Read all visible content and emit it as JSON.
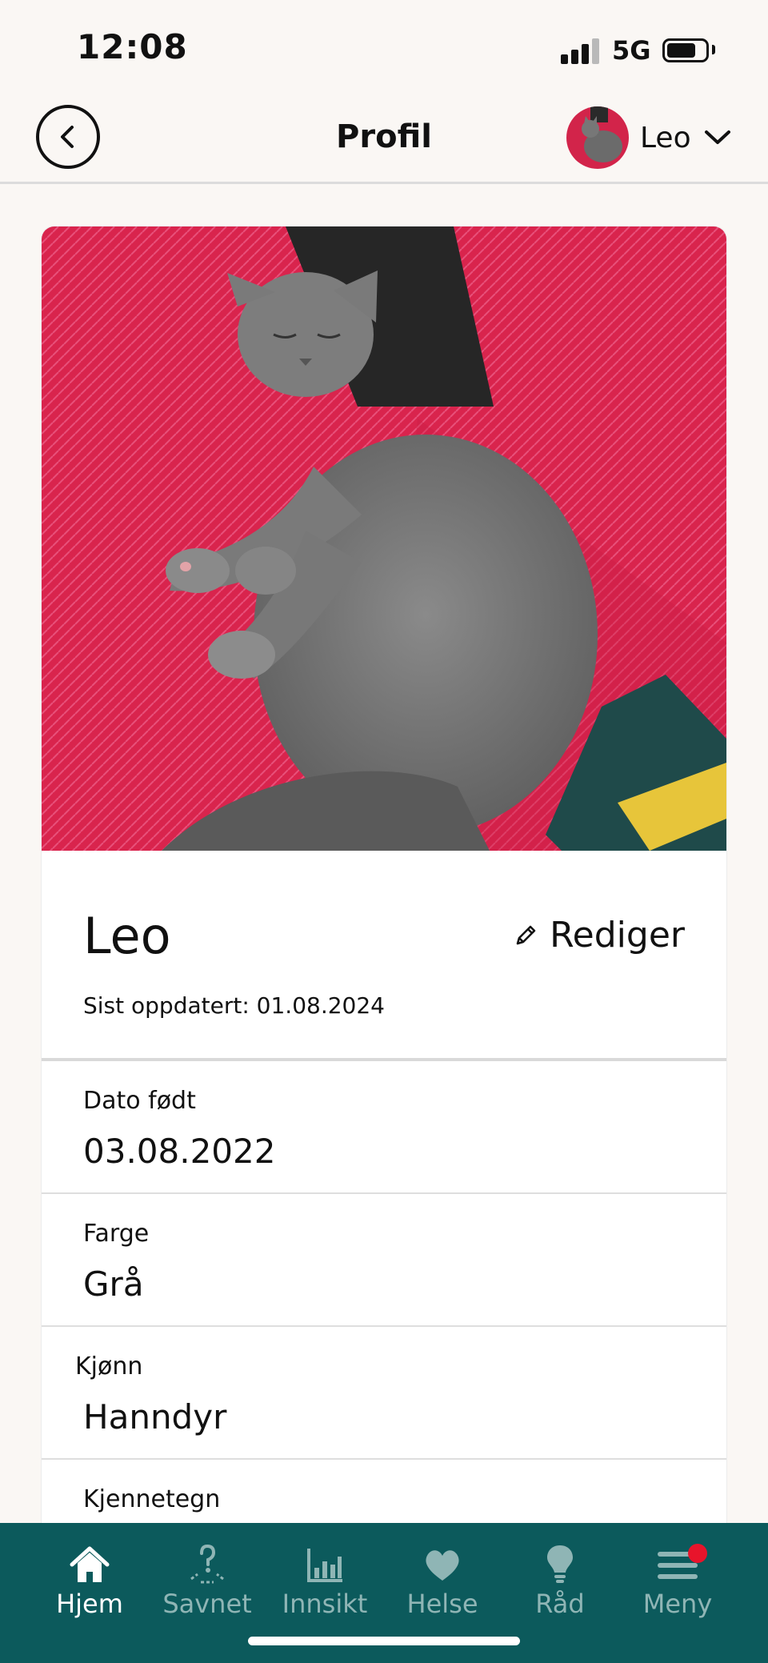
{
  "status_bar": {
    "time": "12:08",
    "network": "5G",
    "battery_level": 0.75
  },
  "header": {
    "title": "Profil",
    "pet_switcher_name": "Leo",
    "back_icon": "chevron-left-icon",
    "switcher_icon": "chevron-down-icon"
  },
  "profile": {
    "name": "Leo",
    "last_updated": "Sist oppdatert: 01.08.2024",
    "edit_label": "Rediger",
    "edit_icon": "pencil-icon",
    "photo": "grey cat lying on red sofa",
    "fields": [
      {
        "label": "Dato født",
        "value": "03.08.2022"
      },
      {
        "label": "Farge",
        "value": "Grå"
      },
      {
        "label": "Kjønn",
        "value": "Hanndyr"
      },
      {
        "label": "Kjennetegn",
        "value": ""
      }
    ]
  },
  "tabbar": {
    "accent": "#0c5a5c",
    "tabs": [
      {
        "label": "Hjem",
        "icon": "home-icon",
        "active": true
      },
      {
        "label": "Savnet",
        "icon": "missing-question-icon",
        "active": false
      },
      {
        "label": "Innsikt",
        "icon": "bar-chart-icon",
        "active": false
      },
      {
        "label": "Helse",
        "icon": "heart-icon",
        "active": false
      },
      {
        "label": "Råd",
        "icon": "lightbulb-icon",
        "active": false
      },
      {
        "label": "Meny",
        "icon": "hamburger-menu-icon",
        "active": false,
        "badge": true
      }
    ]
  }
}
